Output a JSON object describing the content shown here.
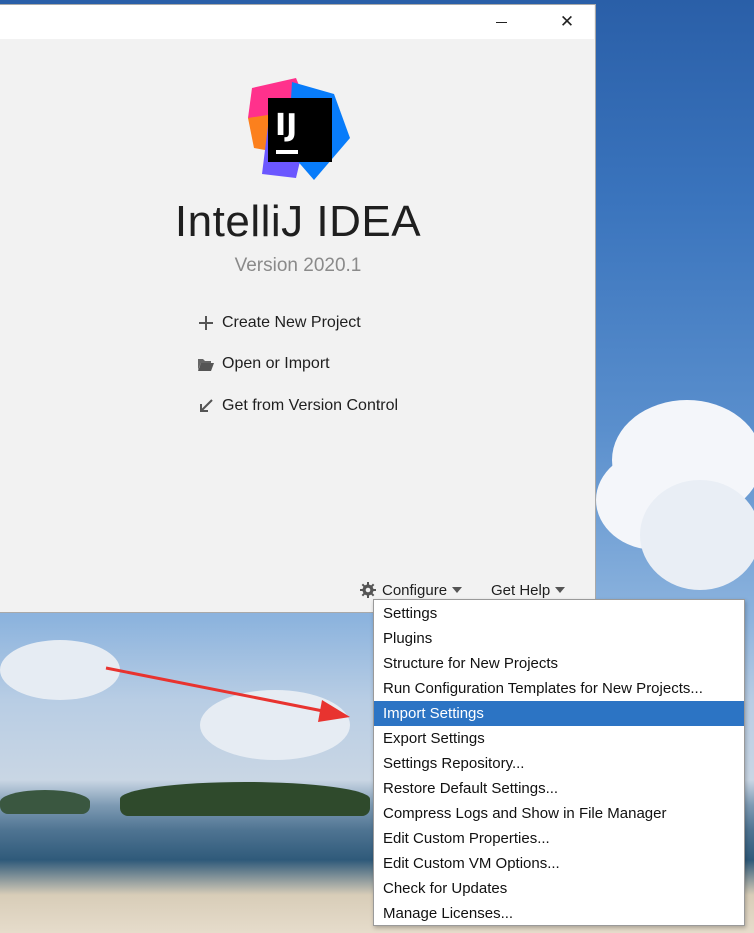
{
  "window": {
    "app_title": "IntelliJ IDEA",
    "version": "Version 2020.1",
    "logo_text": "IJ",
    "controls": {
      "minimize": "minimize",
      "close": "✕"
    }
  },
  "actions": [
    {
      "label": "Create New Project",
      "icon": "plus-icon"
    },
    {
      "label": "Open or Import",
      "icon": "folder-open-icon"
    },
    {
      "label": "Get from Version Control",
      "icon": "arrow-down-left-icon"
    }
  ],
  "footer": {
    "configure_label": "Configure",
    "get_help_label": "Get Help",
    "configure_icon": "gear-icon"
  },
  "configure_menu": {
    "selected_index": 4,
    "items": [
      "Settings",
      "Plugins",
      "Structure for New Projects",
      "Run Configuration Templates for New Projects...",
      "Import Settings",
      "Export Settings",
      "Settings Repository...",
      "Restore Default Settings...",
      "Compress Logs and Show in File Manager",
      "Edit Custom Properties...",
      "Edit Custom VM Options...",
      "Check for Updates",
      "Manage Licenses..."
    ]
  },
  "colors": {
    "selection": "#2c74c4",
    "annotation_arrow": "#e8332f",
    "logo_pink": "#ff318c",
    "logo_orange": "#fc801d",
    "logo_blue": "#087cfa",
    "logo_purple": "#6b57ff"
  }
}
